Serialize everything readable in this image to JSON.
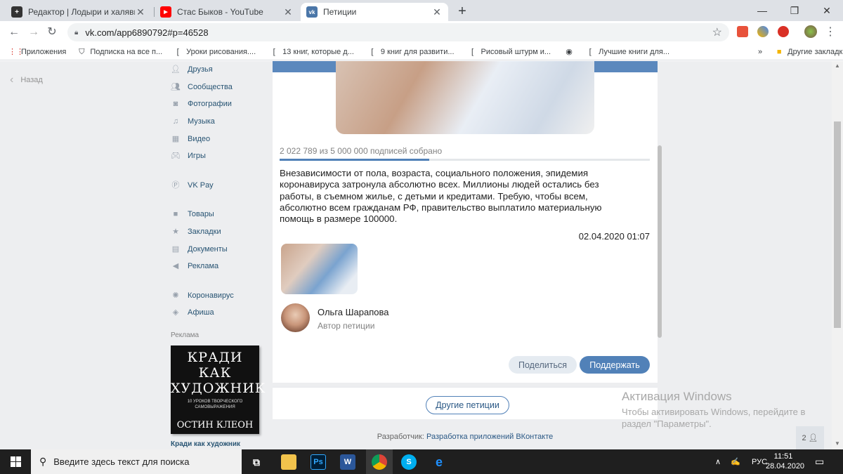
{
  "browser": {
    "tabs": [
      {
        "title": "Редактор | Лодыри и халявщики",
        "favicon_color": "#333333",
        "favicon_glyph": "+"
      },
      {
        "title": "Стас Быков - YouTube",
        "favicon_color": "#ff0000",
        "favicon_glyph": "▶"
      },
      {
        "title": "Петиции",
        "favicon_color": "#4a76a8",
        "favicon_glyph": "vk"
      }
    ],
    "url": "vk.com/app6890792#p=46528",
    "bookmarks": [
      {
        "label": "Приложения",
        "icon": "apps-grid-icon"
      },
      {
        "label": "Подписка на все п...",
        "icon": "shield-icon"
      },
      {
        "label": "Уроки рисования....",
        "icon": "bracket-icon"
      },
      {
        "label": "13 книг, которые д...",
        "icon": "bracket-icon"
      },
      {
        "label": "9 книг для развити...",
        "icon": "bracket-icon"
      },
      {
        "label": "Рисовый штурм и...",
        "icon": "bracket-icon"
      },
      {
        "label": "",
        "icon": "globe-icon"
      },
      {
        "label": "Лучшие книги для...",
        "icon": "bracket-icon"
      }
    ],
    "more_bookmarks": "»",
    "other_bookmarks": "Другие закладки"
  },
  "sidebar": {
    "back": "Назад",
    "menu": [
      {
        "label": "Друзья",
        "icon": "friends-icon"
      },
      {
        "label": "Сообщества",
        "icon": "groups-icon"
      },
      {
        "label": "Фотографии",
        "icon": "camera-icon"
      },
      {
        "label": "Музыка",
        "icon": "music-icon"
      },
      {
        "label": "Видео",
        "icon": "video-icon"
      },
      {
        "label": "Игры",
        "icon": "gamepad-icon"
      },
      {
        "label": "VK Pay",
        "icon": "vkpay-icon"
      },
      {
        "label": "Товары",
        "icon": "bag-icon"
      },
      {
        "label": "Закладки",
        "icon": "star-icon"
      },
      {
        "label": "Документы",
        "icon": "document-icon"
      },
      {
        "label": "Реклама",
        "icon": "megaphone-icon"
      },
      {
        "label": "Коронавирус",
        "icon": "virus-icon"
      },
      {
        "label": "Афиша",
        "icon": "poster-icon"
      }
    ],
    "ads_title": "Реклама",
    "ad_book": {
      "cover_title": "КРАДИ КАК ХУДОЖНИК",
      "cover_subtitle": "10 УРОКОВ ТВОРЧЕСКОГО САМОВЫРАЖЕНИЯ",
      "cover_author": "ОСТИН КЛЕОН",
      "caption": "Кради как художник"
    }
  },
  "petition": {
    "progress_text": "2 022 789 из 5 000 000 подписей собрано",
    "progress_value": 2022789,
    "progress_goal": 5000000,
    "description": "Внезависимости от пола, возраста, социального положения, эпидемия коронавируса затронула абсолютно всех. Миллионы людей остались без работы, в съемном жилье, с детьми и кредитами. Требую, чтобы всем, абсолютно всем гражданам РФ, правительство выплатило материальную помощь в размере 100000.",
    "date": "02.04.2020 01:07",
    "author_name": "Ольга Шарапова",
    "author_role": "Автор петиции",
    "share_label": "Поделиться",
    "support_label": "Поддержать",
    "other_label": "Другие петиции",
    "developer_prefix": "Разработчик:",
    "developer_link": "Разработка приложений ВКонтакте"
  },
  "windows_activation": {
    "title": "Активация Windows",
    "line1": "Чтобы активировать Windows, перейдите в",
    "line2": "раздел \"Параметры\"."
  },
  "counter_badge": "2",
  "taskbar": {
    "search_placeholder": "Введите здесь текст для поиска",
    "lang": "РУС",
    "time": "11:51",
    "date": "28.04.2020"
  },
  "colors": {
    "vk_blue": "#5181b8",
    "link": "#2a5885",
    "page_bg": "#edeef0"
  }
}
